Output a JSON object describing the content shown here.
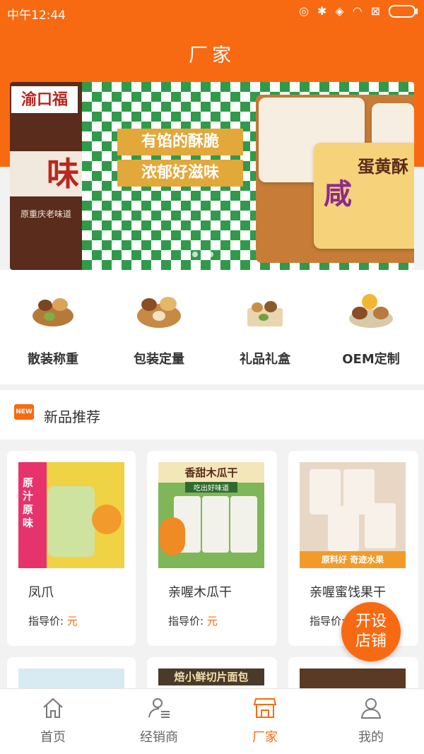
{
  "status_bar": {
    "time": "中午12:44"
  },
  "header": {
    "title": "厂家"
  },
  "banner": {
    "logo": "渝口福",
    "big_text": "味",
    "sub_text": "原重庆老味道",
    "tag1": "有馅的酥脆",
    "tag2": "浓郁好滋味",
    "pack_char": "咸",
    "pack_name": "蛋黄酥"
  },
  "categories": [
    {
      "label": "散装称重",
      "icon": "nuts-mix-icon"
    },
    {
      "label": "包装定量",
      "icon": "nuts-bowl-icon"
    },
    {
      "label": "礼品礼盒",
      "icon": "gift-box-icon"
    },
    {
      "label": "OEM定制",
      "icon": "nuts-plate-icon"
    }
  ],
  "section": {
    "badge": "NEW",
    "title": "新品推荐"
  },
  "products": [
    {
      "name": "凤爪",
      "price_label": "指导价:",
      "price_unit": "元",
      "img_text": "原汁原味"
    },
    {
      "name": "亲喔木瓜干",
      "price_label": "指导价:",
      "price_unit": "元",
      "img_text": "香甜木瓜干",
      "img_sub": "吃出好味道"
    },
    {
      "name": "亲喔蜜饯果干",
      "price_label": "指导价:",
      "price_unit": "元",
      "img_text": "原料好 奇迹水果"
    }
  ],
  "partial_row": {
    "item2_text": "焙小鲜切片面包"
  },
  "fab": {
    "line1": "开设",
    "line2": "店铺"
  },
  "tabbar": [
    {
      "label": "首页",
      "icon": "home-icon",
      "active": false
    },
    {
      "label": "经销商",
      "icon": "distributor-icon",
      "active": false
    },
    {
      "label": "厂家",
      "icon": "store-icon",
      "active": true
    },
    {
      "label": "我的",
      "icon": "user-icon",
      "active": false
    }
  ],
  "colors": {
    "accent": "#f86a12"
  }
}
